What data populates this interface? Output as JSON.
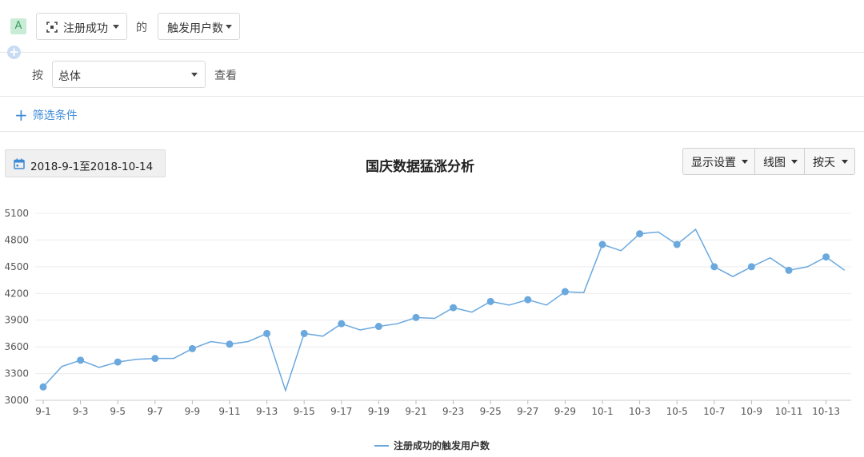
{
  "query": {
    "badge": "A",
    "event": "注册成功",
    "of_label": "的",
    "metric": "触发用户数",
    "by_label": "按",
    "group_by": "总体",
    "view_label": "查看",
    "filter_label": "筛选条件"
  },
  "toolbar": {
    "date_range": "2018-9-1至2018-10-14",
    "display_settings": "显示设置",
    "chart_type": "线图",
    "granularity": "按天"
  },
  "colors": {
    "series": "#6aa8de",
    "link": "#3d8ad6"
  },
  "chart_data": {
    "type": "line",
    "title": "国庆数据猛涨分析",
    "ylim": [
      3000,
      5100
    ],
    "yticks": [
      3000,
      3300,
      3600,
      3900,
      4200,
      4500,
      4800,
      5100
    ],
    "grid": true,
    "legend_position": "bottom-center",
    "x": [
      "9-1",
      "9-2",
      "9-3",
      "9-4",
      "9-5",
      "9-6",
      "9-7",
      "9-8",
      "9-9",
      "9-10",
      "9-11",
      "9-12",
      "9-13",
      "9-14",
      "9-15",
      "9-16",
      "9-17",
      "9-18",
      "9-19",
      "9-20",
      "9-21",
      "9-22",
      "9-23",
      "9-24",
      "9-25",
      "9-26",
      "9-27",
      "9-28",
      "9-29",
      "9-30",
      "10-1",
      "10-2",
      "10-3",
      "10-4",
      "10-5",
      "10-6",
      "10-7",
      "10-8",
      "10-9",
      "10-10",
      "10-11",
      "10-12",
      "10-13",
      "10-14"
    ],
    "xtick_labels": [
      "9-1",
      "9-3",
      "9-5",
      "9-7",
      "9-9",
      "9-11",
      "9-13",
      "9-15",
      "9-17",
      "9-19",
      "9-21",
      "9-23",
      "9-25",
      "9-27",
      "9-29",
      "10-1",
      "10-3",
      "10-5",
      "10-7",
      "10-9",
      "10-11",
      "10-13"
    ],
    "series": [
      {
        "name": "注册成功的触发用户数",
        "values": [
          3150,
          3380,
          3450,
          3370,
          3430,
          3460,
          3470,
          3470,
          3580,
          3660,
          3630,
          3660,
          3750,
          3110,
          3750,
          3720,
          3860,
          3790,
          3830,
          3860,
          3930,
          3920,
          4040,
          3990,
          4110,
          4070,
          4130,
          4070,
          4220,
          4210,
          4750,
          4680,
          4870,
          4890,
          4750,
          4920,
          4500,
          4390,
          4500,
          4600,
          4460,
          4500,
          4610,
          4460
        ]
      }
    ]
  }
}
